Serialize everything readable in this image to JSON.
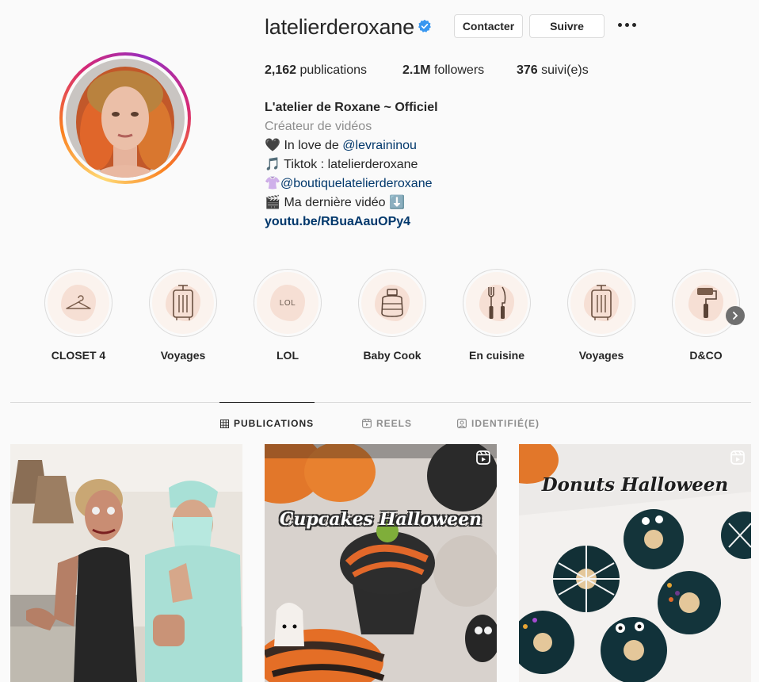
{
  "profile": {
    "username": "latelierderoxane",
    "verified": true,
    "contact_label": "Contacter",
    "follow_label": "Suivre",
    "stats": {
      "posts_count": "2,162",
      "posts_label": " publications",
      "followers_count": "2.1M",
      "followers_label": " followers",
      "following_count": "376",
      "following_label": " suivi(e)s"
    },
    "bio": {
      "full_name": "L'atelier de Roxane ~ Officiel",
      "category": "Créateur de vidéos",
      "line1_emoji": "🖤",
      "line1_text": " In love de ",
      "line1_mention": "@levraininou",
      "line2_emoji": "🎵",
      "line2_text": " Tiktok : latelierderoxane",
      "line3_emoji": "👚",
      "line3_mention": "@boutiquelatelierderoxane",
      "line4_emoji": "🎬",
      "line4_text": " Ma dernière vidéo ",
      "line4_end_emoji": "⬇️",
      "link": "youtu.be/RBuaAauOPy4"
    }
  },
  "highlights": [
    {
      "label": "CLOSET 4",
      "icon": "hanger-icon"
    },
    {
      "label": "Voyages",
      "icon": "suitcase-icon"
    },
    {
      "label": "LOL",
      "icon": "lol-text",
      "text": "LOL"
    },
    {
      "label": "Baby Cook",
      "icon": "baby-food-jar-icon"
    },
    {
      "label": "En cuisine",
      "icon": "fork-knife-icon"
    },
    {
      "label": "Voyages",
      "icon": "suitcase-icon"
    },
    {
      "label": "D&CO",
      "icon": "paint-roller-icon"
    }
  ],
  "tabs": [
    {
      "label": "PUBLICATIONS",
      "icon": "grid-icon",
      "active": true
    },
    {
      "label": "REELS",
      "icon": "reels-icon",
      "active": false
    },
    {
      "label": "IDENTIFIÉ(E)",
      "icon": "tagged-icon",
      "active": false
    }
  ],
  "posts": [
    {
      "type": "photo",
      "overlay_text": ""
    },
    {
      "type": "reel",
      "overlay_text": "Cupcakes Halloween"
    },
    {
      "type": "reel",
      "overlay_text": "Donuts Halloween"
    }
  ],
  "colors": {
    "link": "#00376b",
    "secondary_text": "#8e8e8e",
    "verified_blue": "#3897f0",
    "border": "#dbdbdb"
  }
}
